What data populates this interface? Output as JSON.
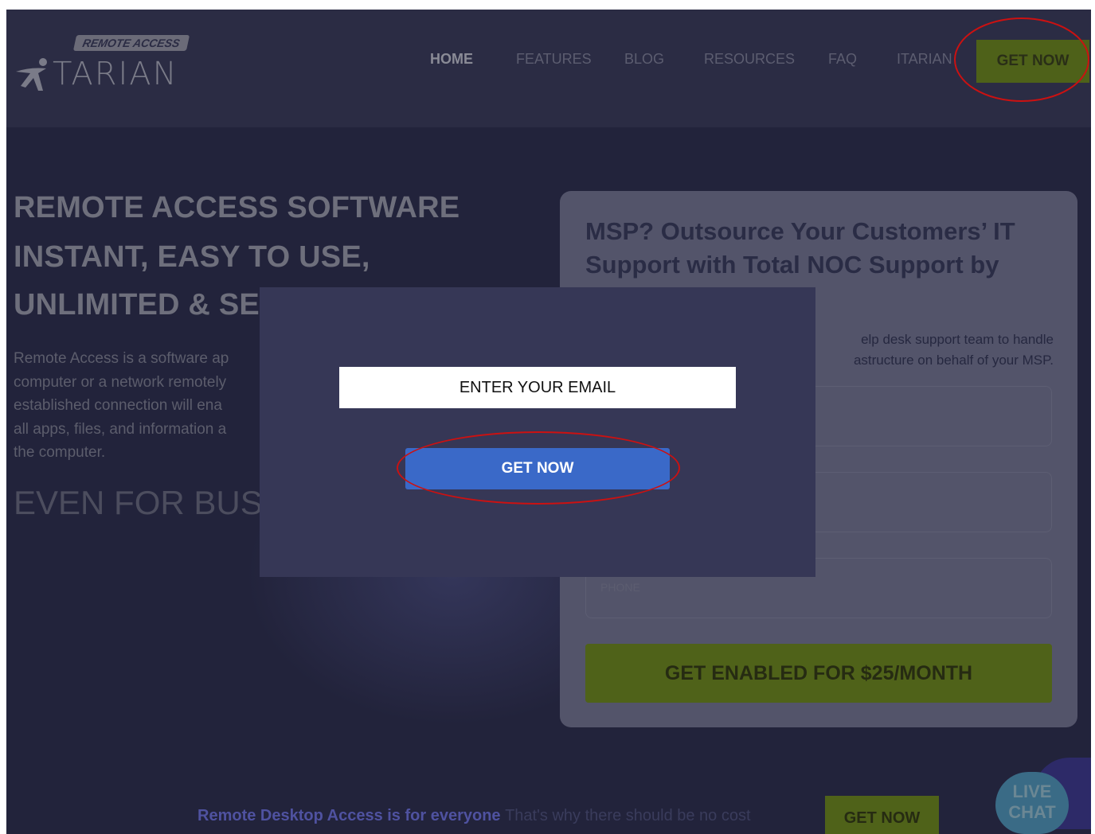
{
  "header": {
    "logo_badge": "REMOTE ACCESS",
    "logo_word": "TARIAN",
    "nav": [
      "HOME",
      "FEATURES",
      "BLOG",
      "RESOURCES",
      "FAQ",
      "ITARIAN"
    ],
    "cta": "GET NOW"
  },
  "hero": {
    "line1": "REMOTE ACCESS SOFTWARE",
    "line2": "INSTANT, EASY TO USE,",
    "line3": "UNLIMITED & SEC",
    "para": [
      "Remote Access is a software ap",
      "computer or a network remotely",
      "established connection will ena",
      "all apps, files, and information a",
      "the computer."
    ],
    "sub": "EVEN FOR BUSIN"
  },
  "card": {
    "title": "MSP? Outsource Your Customers’ IT Support with Total NOC Support by",
    "desc_line1": "elp desk support team to handle",
    "desc_line2": "astructure on behalf of your MSP.",
    "phone_placeholder": "PHONE",
    "cta": "GET ENABLED FOR $25/MONTH"
  },
  "strip": {
    "bold": "Remote Desktop Access is for everyone",
    "light": "That's why there should be no cost",
    "button": "GET NOW"
  },
  "chat": {
    "line1": "LIVE",
    "line2": "CHAT"
  },
  "modal": {
    "email_placeholder": "ENTER YOUR EMAIL",
    "button": "GET NOW"
  },
  "colors": {
    "accent_green": "#4f6219",
    "modal_button": "#3a69c8",
    "annotation_red": "#cc1111"
  }
}
